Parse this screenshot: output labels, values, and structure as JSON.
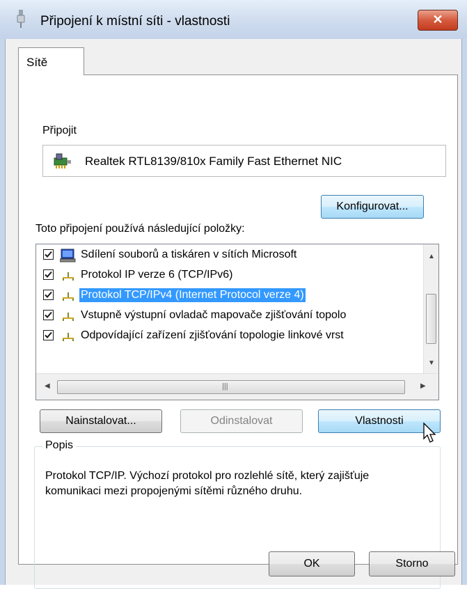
{
  "window": {
    "title": "Připojení k místní síti - vlastnosti",
    "close_label": "✕"
  },
  "tab": {
    "label": "Sítě"
  },
  "connect": {
    "label": "Připojit",
    "adapter": "Realtek RTL8139/810x Family Fast Ethernet NIC",
    "configure_label": "Konfigurovat..."
  },
  "items_section": {
    "label": "Toto připojení používá následující položky:",
    "items": [
      {
        "label": "Sdílení souborů a tiskáren v sítích Microsoft",
        "checked": true,
        "selected": false,
        "icon": "computer-icon"
      },
      {
        "label": "Protokol IP verze 6 (TCP/IPv6)",
        "checked": true,
        "selected": false,
        "icon": "network-protocol-icon"
      },
      {
        "label": "Protokol TCP/IPv4 (Internet Protocol verze 4)",
        "checked": true,
        "selected": true,
        "icon": "network-protocol-icon"
      },
      {
        "label": "Vstupně výstupní ovladač mapovače zjišťování topolo",
        "checked": true,
        "selected": false,
        "icon": "network-protocol-icon"
      },
      {
        "label": "Odpovídající zařízení zjišťování topologie linkové vrst",
        "checked": true,
        "selected": false,
        "icon": "network-protocol-icon"
      }
    ]
  },
  "actions": {
    "install_label": "Nainstalovat...",
    "uninstall_label": "Odinstalovat",
    "properties_label": "Vlastnosti"
  },
  "description": {
    "title": "Popis",
    "text": "Protokol TCP/IP. Výchozí protokol pro rozlehlé sítě, který zajišťuje komunikaci mezi propojenými sítěmi různého druhu."
  },
  "footer": {
    "ok_label": "OK",
    "cancel_label": "Storno"
  },
  "colors": {
    "selection": "#3399ff",
    "frame": "#c7d6ea",
    "close_button": "#d65b3e"
  }
}
